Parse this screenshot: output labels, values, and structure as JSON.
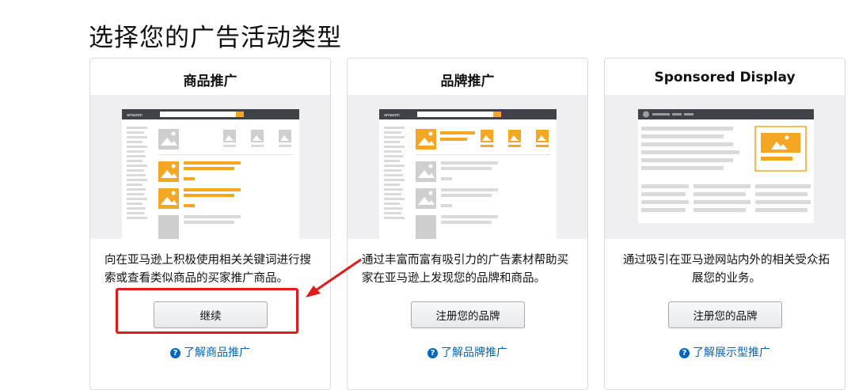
{
  "page": {
    "title": "选择您的广告活动类型"
  },
  "cards": [
    {
      "title": "商品推广",
      "description": "向在亚马逊上积极使用相关关键词进行搜索或查看类似商品的买家推广商品。",
      "button": "继续",
      "link": "了解商品推广"
    },
    {
      "title": "品牌推广",
      "description": "通过丰富而富有吸引力的广告素材帮助买家在亚马逊上发现您的品牌和商品。",
      "button": "注册您的品牌",
      "link": "了解品牌推广"
    },
    {
      "title": "Sponsored Display",
      "description": "通过吸引在亚马逊网站内外的相关受众拓展您的业务。",
      "button": "注册您的品牌",
      "link": "了解展示型推广"
    }
  ],
  "illustration": {
    "logo_text": "amazon"
  },
  "icons": {
    "help": "question-circle-icon",
    "help_glyph": "?"
  },
  "colors": {
    "accent_orange": "#f5a623",
    "link_blue": "#0066c0",
    "annotation_red": "#e01b1b",
    "header_dark": "#3f4247"
  }
}
